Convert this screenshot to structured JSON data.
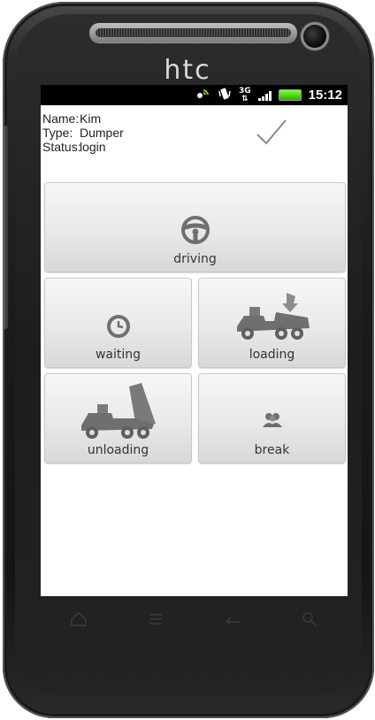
{
  "device": {
    "brand": "htc"
  },
  "status_bar": {
    "time": "15:12",
    "network": "3G",
    "icons": [
      "satellite-icon",
      "vibrate-icon",
      "network-3g-icon",
      "signal-icon",
      "battery-icon"
    ]
  },
  "driver": {
    "name_label": "Name:",
    "name_value": "Kim",
    "type_label": "Type:",
    "type_value": "Dumper",
    "status_label": "Status:",
    "status_value": "login"
  },
  "actions": {
    "driving": {
      "label": "driving",
      "icon": "steering-wheel-icon"
    },
    "waiting": {
      "label": "waiting",
      "icon": "clock-icon"
    },
    "loading": {
      "label": "loading",
      "icon": "dumper-loading-icon"
    },
    "unloading": {
      "label": "unloading",
      "icon": "dumper-unloading-icon"
    },
    "break": {
      "label": "break",
      "icon": "people-icon"
    }
  },
  "nav": [
    "home-icon",
    "menu-icon",
    "back-icon",
    "search-icon"
  ],
  "colors": {
    "statusbar_bg": "#000000",
    "battery": "#3fd11a",
    "tile_bg": "#e9e9e9",
    "icon_gray": "#6f6f6f"
  }
}
